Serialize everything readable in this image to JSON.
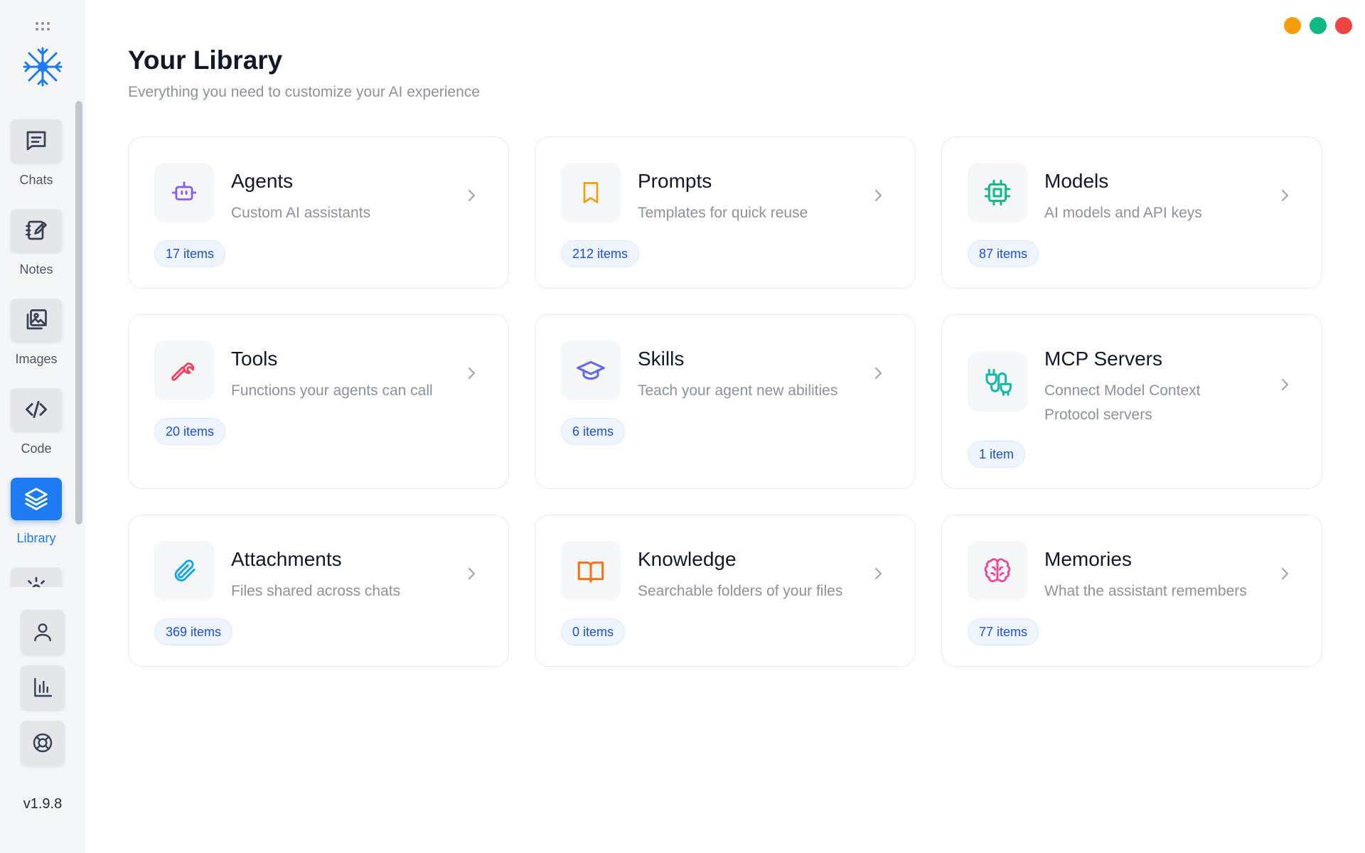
{
  "app": {
    "version": "v1.9.8"
  },
  "sidebar": {
    "nav": [
      {
        "label": "Chats",
        "icon": "chat-icon"
      },
      {
        "label": "Notes",
        "icon": "notes-icon"
      },
      {
        "label": "Images",
        "icon": "images-icon"
      },
      {
        "label": "Code",
        "icon": "code-icon"
      },
      {
        "label": "Library",
        "icon": "layers-icon",
        "active": true
      }
    ],
    "utility_icons": [
      "user-icon",
      "chart-icon",
      "help-icon"
    ],
    "active_color": "#1e7cf2"
  },
  "window_controls": [
    "#f59e0b",
    "#10b981",
    "#ef4444"
  ],
  "page": {
    "title": "Your Library",
    "subtitle": "Everything you need to customize your AI experience"
  },
  "cards": [
    {
      "title": "Agents",
      "desc": "Custom AI assistants",
      "count": "17 items",
      "icon": "robot-icon",
      "color": "#8b5cf6"
    },
    {
      "title": "Prompts",
      "desc": "Templates for quick reuse",
      "count": "212 items",
      "icon": "bookmark-icon",
      "color": "#f59e0b"
    },
    {
      "title": "Models",
      "desc": "AI models and API keys",
      "count": "87 items",
      "icon": "chip-icon",
      "color": "#10b981"
    },
    {
      "title": "Tools",
      "desc": "Functions your agents can call",
      "count": "20 items",
      "icon": "wrench-icon",
      "color": "#f43f5e"
    },
    {
      "title": "Skills",
      "desc": "Teach your agent new abilities",
      "count": "6 items",
      "icon": "graduation-cap-icon",
      "color": "#6366f1"
    },
    {
      "title": "MCP Servers",
      "desc": "Connect Model Context Protocol servers",
      "count": "1 item",
      "icon": "plug-icon",
      "color": "#14b8a6"
    },
    {
      "title": "Attachments",
      "desc": "Files shared across chats",
      "count": "369 items",
      "icon": "paperclip-icon",
      "color": "#0ea5e9"
    },
    {
      "title": "Knowledge",
      "desc": "Searchable folders of your files",
      "count": "0 items",
      "icon": "book-open-icon",
      "color": "#f97316"
    },
    {
      "title": "Memories",
      "desc": "What the assistant remembers",
      "count": "77 items",
      "icon": "brain-icon",
      "color": "#ec4899"
    }
  ]
}
